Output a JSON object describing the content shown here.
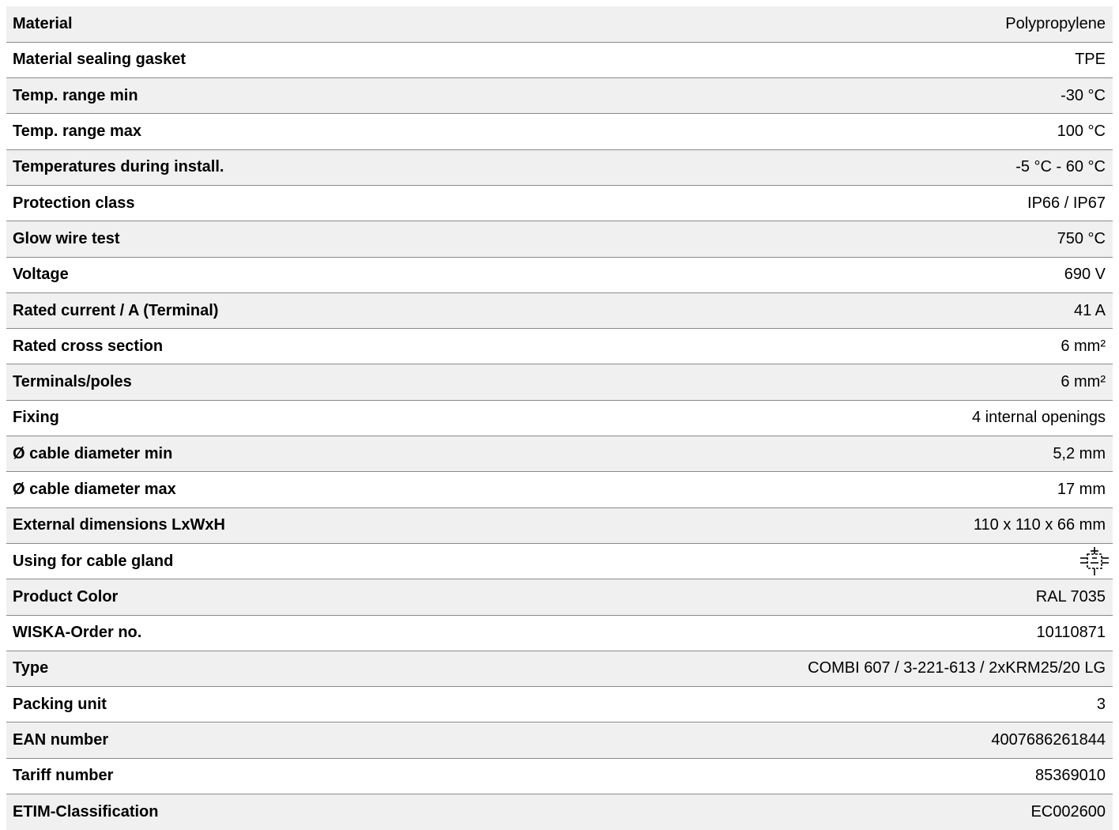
{
  "specs": [
    {
      "label": "Material",
      "value": "Polypropylene"
    },
    {
      "label": "Material sealing gasket",
      "value": "TPE"
    },
    {
      "label": "Temp. range min",
      "value": "-30 °C"
    },
    {
      "label": "Temp. range max",
      "value": "100 °C"
    },
    {
      "label": "Temperatures during install.",
      "value": "-5 °C - 60 °C"
    },
    {
      "label": "Protection class",
      "value": "IP66 / IP67"
    },
    {
      "label": "Glow wire test",
      "value": "750 °C"
    },
    {
      "label": "Voltage",
      "value": "690 V"
    },
    {
      "label": "Rated current / A (Terminal)",
      "value": "41 A"
    },
    {
      "label": "Rated cross section",
      "value": "6 mm²"
    },
    {
      "label": "Terminals/poles",
      "value": "6 mm²"
    },
    {
      "label": "Fixing",
      "value": "4 internal openings"
    },
    {
      "label": "Ø cable diameter min",
      "value": "5,2 mm"
    },
    {
      "label": "Ø cable diameter max",
      "value": "17 mm"
    },
    {
      "label": "External dimensions LxWxH",
      "value": "110 x 110 x 66 mm"
    },
    {
      "label": "Using for cable gland",
      "icon": "cable-gland-box-icon"
    },
    {
      "label": "Product Color",
      "value": "RAL 7035"
    },
    {
      "label": "WISKA-Order no.",
      "value": "10110871"
    },
    {
      "label": "Type",
      "value": "COMBI 607 / 3-221-613 / 2xKRM25/20 LG"
    },
    {
      "label": "Packing unit",
      "value": "3"
    },
    {
      "label": "EAN number",
      "value": "4007686261844"
    },
    {
      "label": "Tariff number",
      "value": "85369010"
    },
    {
      "label": "ETIM-Classification",
      "value": "EC002600"
    }
  ]
}
